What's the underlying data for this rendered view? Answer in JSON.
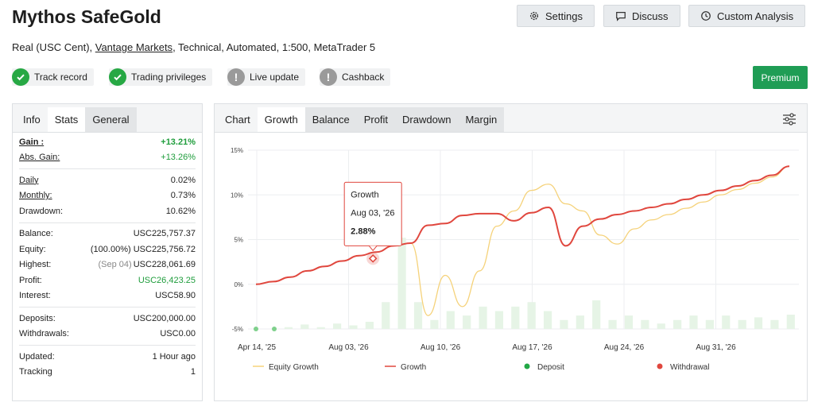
{
  "header": {
    "title": "Mythos SafeGold",
    "buttons": {
      "settings": "Settings",
      "discuss": "Discuss",
      "custom_analysis": "Custom Analysis"
    },
    "subtitle_pre": "Real (USC Cent), ",
    "broker": "Vantage Markets",
    "subtitle_post": ", Technical, Automated, 1:500, MetaTrader 5"
  },
  "badges": [
    {
      "label": "Track record",
      "status": "ok"
    },
    {
      "label": "Trading privileges",
      "status": "ok"
    },
    {
      "label": "Live update",
      "status": "warn"
    },
    {
      "label": "Cashback",
      "status": "warn"
    }
  ],
  "premium_label": "Premium",
  "left_tabs": [
    "Info",
    "Stats",
    "General"
  ],
  "stats": {
    "gain": {
      "label": "Gain :",
      "value": "+13.21%"
    },
    "abs_gain": {
      "label": "Abs. Gain:",
      "value": "+13.26%"
    },
    "daily": {
      "label": "Daily",
      "value": "0.02%"
    },
    "monthly": {
      "label": "Monthly:",
      "value": "0.73%"
    },
    "drawdown": {
      "label": "Drawdown:",
      "value": "10.62%"
    },
    "balance": {
      "label": "Balance:",
      "value": "USC225,757.37"
    },
    "equity": {
      "label": "Equity:",
      "note": "(100.00%)",
      "value": "USC225,756.72"
    },
    "highest": {
      "label": "Highest:",
      "note": "(Sep 04)",
      "value": "USC228,061.69"
    },
    "profit": {
      "label": "Profit:",
      "value": "USC26,423.25"
    },
    "interest": {
      "label": "Interest:",
      "value": "USC58.90"
    },
    "deposits": {
      "label": "Deposits:",
      "value": "USC200,000.00"
    },
    "withdrawals": {
      "label": "Withdrawals:",
      "value": "USC0.00"
    },
    "updated": {
      "label": "Updated:",
      "value": "1 Hour ago"
    },
    "tracking": {
      "label": "Tracking",
      "value": "1"
    }
  },
  "chart_tabs": [
    "Chart",
    "Growth",
    "Balance",
    "Profit",
    "Drawdown",
    "Margin"
  ],
  "colors": {
    "growth": "#e0473e",
    "equity": "#f5d27a",
    "deposit": "#22a846",
    "withdrawal": "#e0473e",
    "bars": "#e6f4e6",
    "accent": "#1f9d55"
  },
  "chart_data": {
    "type": "line",
    "x": [
      "Apr 14, '25",
      "Aug 03, '26",
      "Aug 10, '26",
      "Aug 17, '26",
      "Aug 24, '26",
      "Aug 31, '26"
    ],
    "ylim": [
      -5,
      15
    ],
    "yticks": [
      "15%",
      "10%",
      "5%",
      "0%",
      "-5%"
    ],
    "ytick_values": [
      15,
      10,
      5,
      0,
      -5
    ],
    "series": [
      {
        "name": "Equity Growth",
        "color": "#f5d27a",
        "values": [
          0,
          0.3,
          0.8,
          1.5,
          2.0,
          2.6,
          3.2,
          3.6,
          4.3,
          4.6,
          -3.5,
          1.0,
          -2.5,
          1.5,
          6.5,
          8.2,
          10.5,
          11.2,
          9.0,
          8.2,
          5.5,
          4.5,
          6.2,
          7.2,
          7.8,
          8.5,
          9.2,
          10.0,
          10.6,
          11.3,
          12.0,
          13.2
        ]
      },
      {
        "name": "Growth",
        "color": "#e0473e",
        "values": [
          0,
          0.3,
          0.8,
          1.5,
          2.0,
          2.6,
          3.2,
          3.6,
          4.3,
          4.6,
          6.6,
          6.8,
          7.7,
          7.9,
          7.9,
          7.1,
          8.0,
          8.6,
          4.3,
          6.5,
          7.3,
          7.8,
          8.2,
          8.6,
          9.0,
          9.5,
          10.0,
          10.5,
          11.0,
          11.6,
          12.2,
          13.2
        ]
      },
      {
        "name": "Deposit",
        "color": "#22a846",
        "values": [
          -5,
          -5
        ]
      },
      {
        "name": "Withdrawal",
        "color": "#e0473e",
        "values": []
      }
    ],
    "bars": [
      0,
      0,
      0.2,
      0.5,
      0.2,
      0.6,
      0.4,
      0.8,
      3.0,
      10.2,
      3.0,
      1.0,
      2.0,
      1.5,
      2.5,
      2.0,
      2.5,
      3.0,
      2.0,
      1.0,
      1.5,
      3.2,
      1.0,
      1.5,
      1.0,
      0.6,
      1.0,
      1.5,
      1.0,
      1.5,
      1.0,
      1.3,
      1.0,
      1.6
    ],
    "tooltip": {
      "title": "Growth",
      "date": "Aug 03, '26",
      "value": "2.88%",
      "point_value": 2.88,
      "point_index": 6.8
    },
    "legend": [
      "Equity Growth",
      "Growth",
      "Deposit",
      "Withdrawal"
    ],
    "legend_position": "bottom",
    "grid": true
  }
}
